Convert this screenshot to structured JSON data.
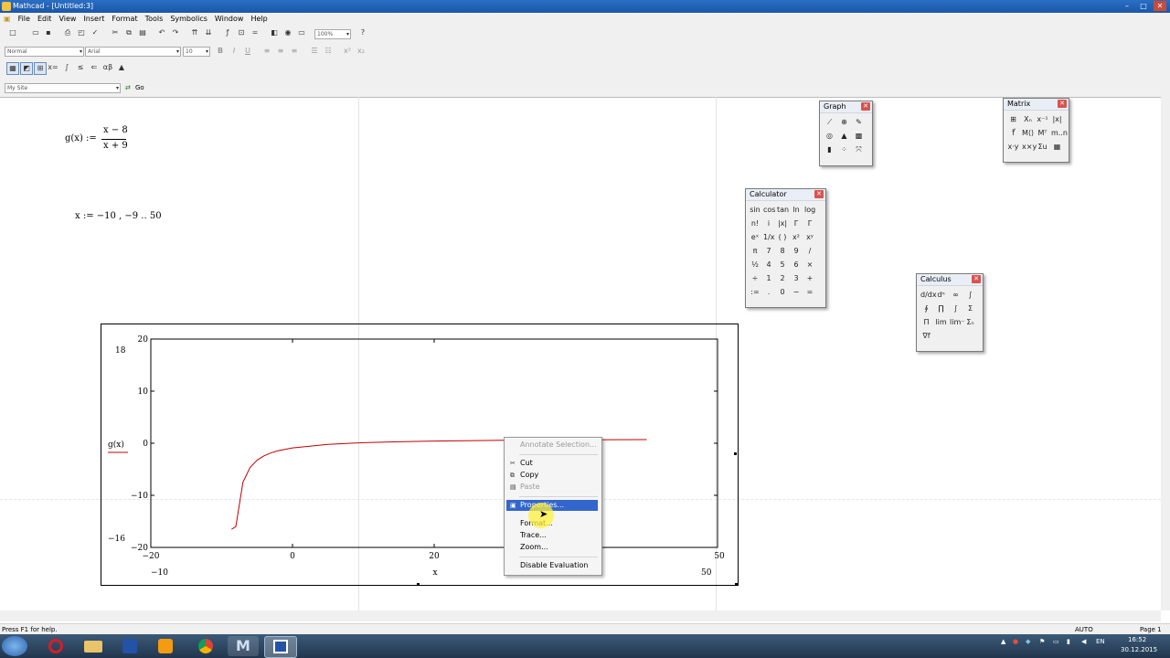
{
  "window": {
    "title": "Mathcad - [Untitled:3]"
  },
  "menu": [
    "File",
    "Edit",
    "View",
    "Insert",
    "Format",
    "Tools",
    "Symbolics",
    "Window",
    "Help"
  ],
  "toolbar": {
    "zoom": "100%",
    "style": "Normal",
    "font": "Arial",
    "size": "10",
    "bold": "B",
    "italic": "I",
    "underline": "U"
  },
  "resources": {
    "site": "My Site",
    "go": "Go"
  },
  "worksheet": {
    "func_lhs": "g(x) :=",
    "func_num": "x − 8",
    "func_den": "x + 9",
    "range_def": "x := −10 , −9 .. 50"
  },
  "chart_data": {
    "type": "line",
    "series": [
      {
        "name": "g(x)",
        "color": "#c00000",
        "function": "(x-8)/(x+9)",
        "x": [
          -8.6,
          -8.0,
          -7.0,
          -6.0,
          -5.0,
          -4.0,
          -3.0,
          -2.0,
          0.0,
          5.0,
          10.0,
          15.0,
          20.0,
          30.0,
          40.0,
          50.0
        ],
        "y": [
          -16.5,
          -16.0,
          -7.5,
          -4.67,
          -3.25,
          -2.4,
          -1.83,
          -1.43,
          -0.89,
          -0.21,
          0.11,
          0.29,
          0.41,
          0.56,
          0.65,
          0.71
        ]
      }
    ],
    "xlim": [
      -20,
      60
    ],
    "ylim": [
      -20,
      20
    ],
    "xticks": [
      "−20",
      "0",
      "20",
      "50"
    ],
    "yticks": [
      "20",
      "10",
      "0",
      "−10",
      "−20"
    ],
    "ymarker_top": "18",
    "ymarker_bottom": "−16",
    "xmarker_left": "−10",
    "xmarker_right": "50",
    "xlabel": "x",
    "ylabel": "g(x)"
  },
  "context_menu": {
    "items": [
      {
        "label": "Annotate Selection...",
        "disabled": true
      },
      {
        "label": "Cut",
        "disabled": false
      },
      {
        "label": "Copy",
        "disabled": false
      },
      {
        "label": "Paste",
        "disabled": true
      },
      {
        "label": "Properties...",
        "selected": true
      },
      {
        "label": "Format...",
        "disabled": false
      },
      {
        "label": "Trace...",
        "disabled": false
      },
      {
        "label": "Zoom...",
        "disabled": false
      },
      {
        "label": "Disable Evaluation",
        "disabled": false
      }
    ]
  },
  "palettes": {
    "graph": {
      "title": "Graph"
    },
    "matrix": {
      "title": "Matrix"
    },
    "calculator": {
      "title": "Calculator",
      "keys": [
        "sin",
        "cos",
        "tan",
        "ln",
        "log",
        "n!",
        "i",
        "|x|",
        "Γ",
        "Γ",
        "eˣ",
        "1/x",
        "( )",
        "x²",
        "xʸ",
        "π",
        "7",
        "8",
        "9",
        "/",
        "½",
        "4",
        "5",
        "6",
        "×",
        "÷",
        "1",
        "2",
        "3",
        "+",
        ":=",
        ".",
        "0",
        "−",
        "="
      ]
    },
    "calculus": {
      "title": "Calculus"
    }
  },
  "status": {
    "help": "Press F1 for help.",
    "mode": "AUTO",
    "page": "Page 1"
  },
  "tray": {
    "time": "16:52",
    "date": "30.12.2015"
  }
}
